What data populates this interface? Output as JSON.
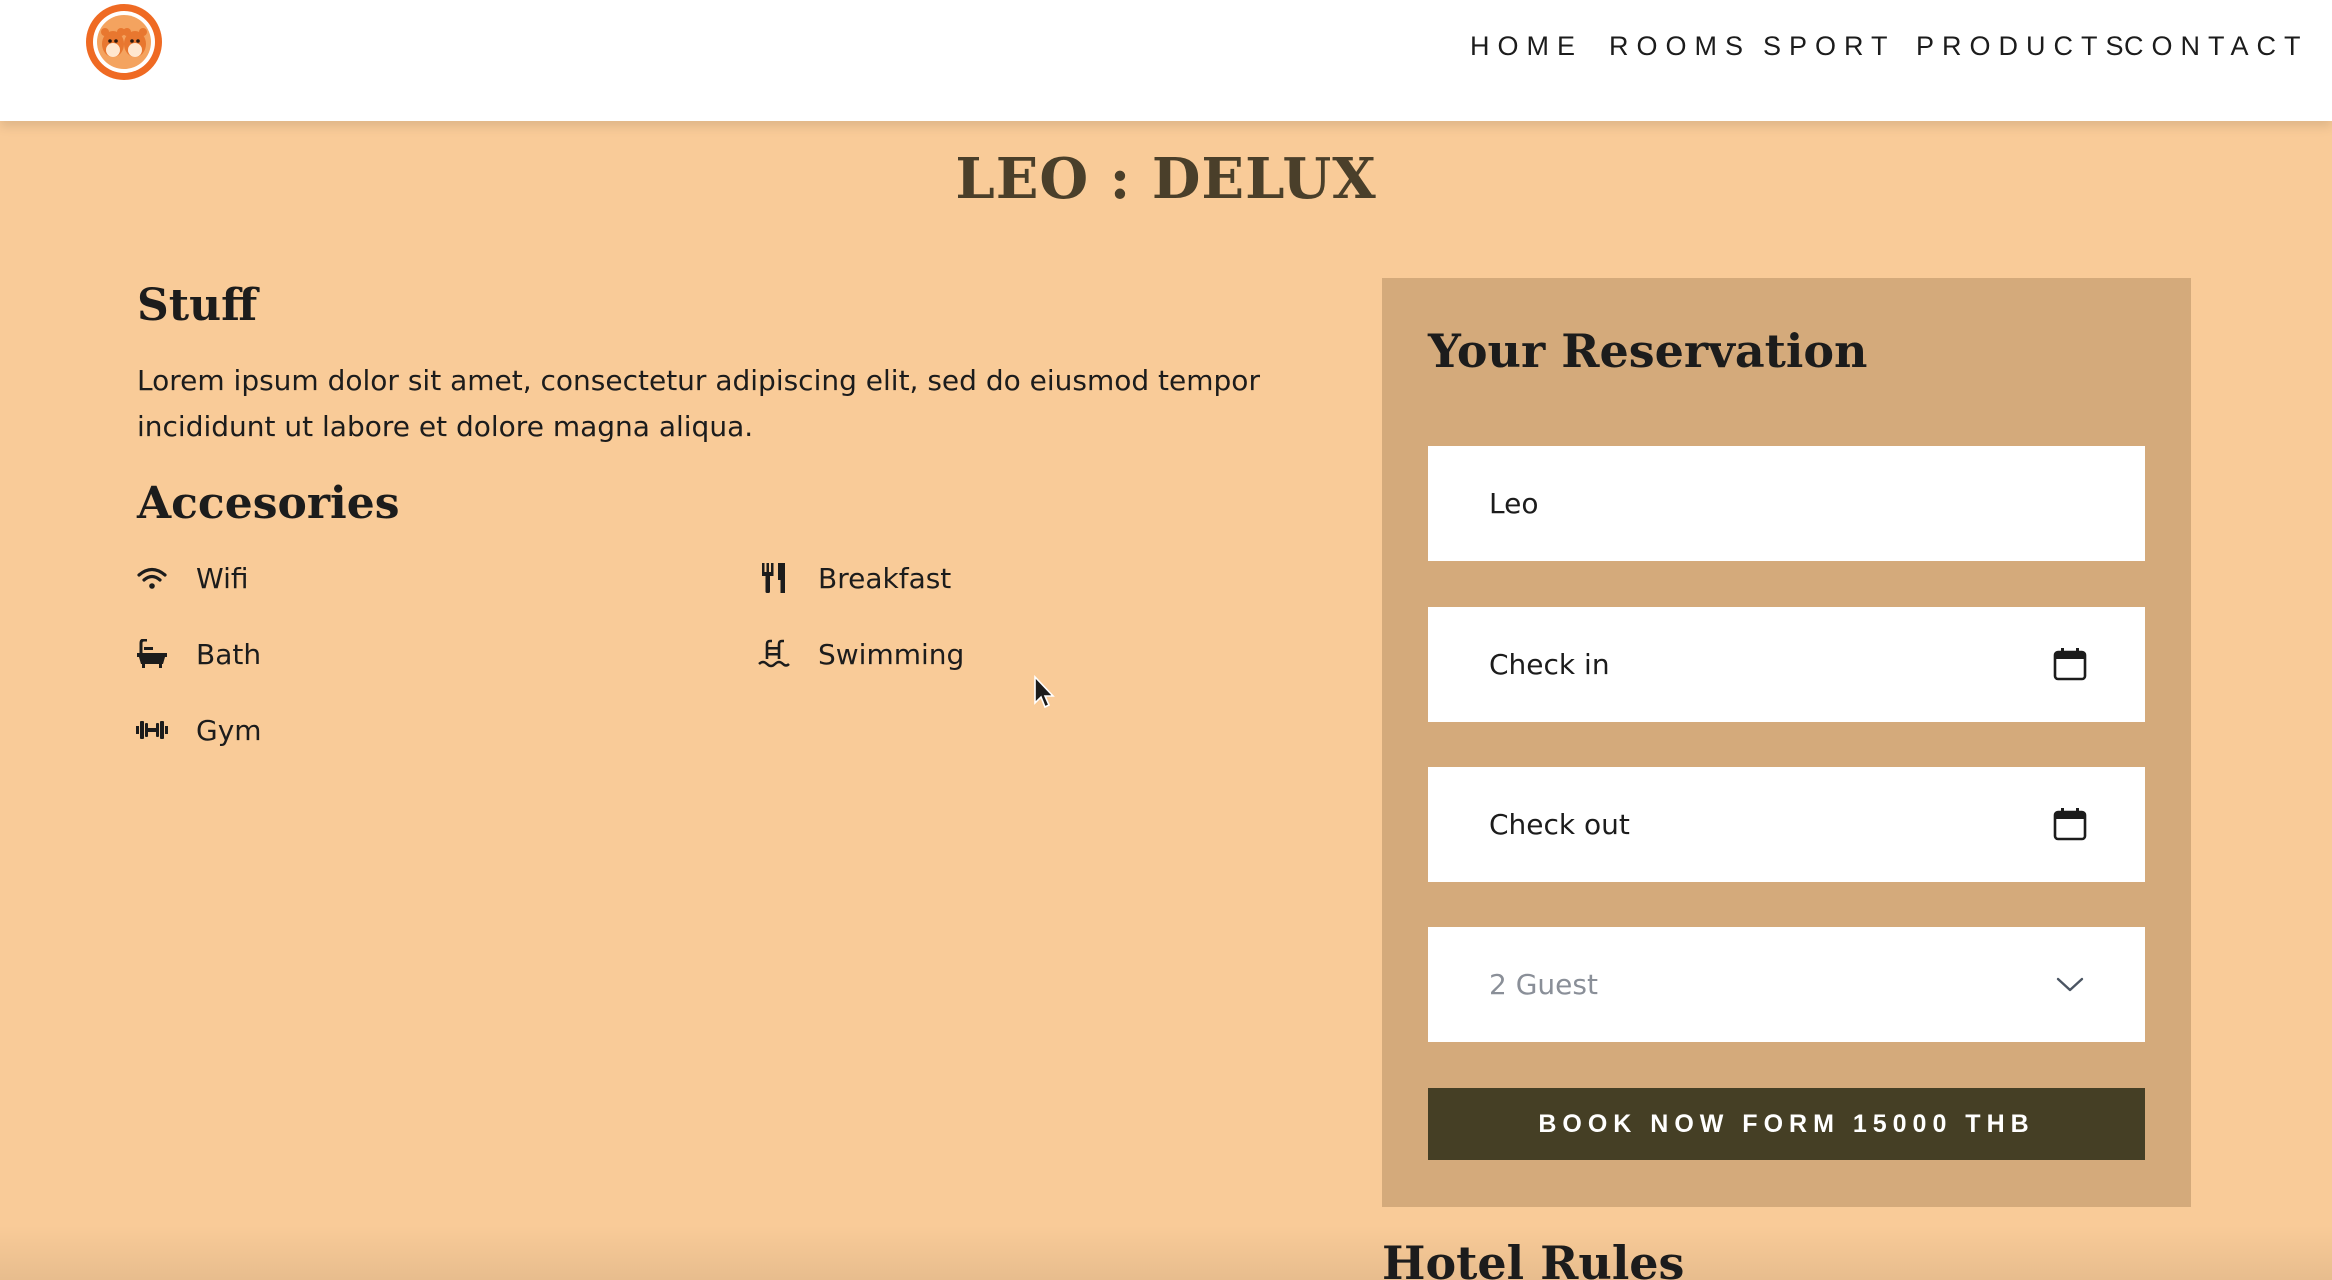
{
  "header": {
    "logo_icon": "hamster-logo-icon",
    "nav": [
      {
        "label": "HOME"
      },
      {
        "label": "ROOMS"
      },
      {
        "label": "SPORT"
      },
      {
        "label": "PRODUCTS"
      },
      {
        "label": "CONTACT"
      }
    ]
  },
  "page": {
    "title": "LEO : DELUX"
  },
  "stuff": {
    "heading": "Stuff",
    "text": "Lorem ipsum dolor sit amet, consectetur adipiscing elit, sed do eiusmod tempor incididunt ut labore et dolore magna aliqua."
  },
  "accessories": {
    "heading": "Accesories",
    "items": [
      {
        "label": "Wifi",
        "icon": "wifi-icon"
      },
      {
        "label": "Breakfast",
        "icon": "utensils-icon"
      },
      {
        "label": "Bath",
        "icon": "bath-icon"
      },
      {
        "label": "Swimming",
        "icon": "swimming-icon"
      },
      {
        "label": "Gym",
        "icon": "dumbbell-icon"
      }
    ]
  },
  "reservation": {
    "title": "Your Reservation",
    "name_value": "Leo",
    "checkin_value": "Check in",
    "checkout_value": "Check out",
    "guest_selected": "2 Guest",
    "calendar_icon": "calendar-icon",
    "dropdown_icon": "chevron-down-icon",
    "book_label": "BOOK NOW FORM 15000 THB"
  },
  "rules": {
    "heading": "Hotel Rules"
  },
  "colors": {
    "page_bg": "#f9cb98",
    "card_bg": "#d4aa7b",
    "button_bg": "#453f25",
    "title_color": "#4a3f2a",
    "logo_orange": "#ef6a23"
  }
}
